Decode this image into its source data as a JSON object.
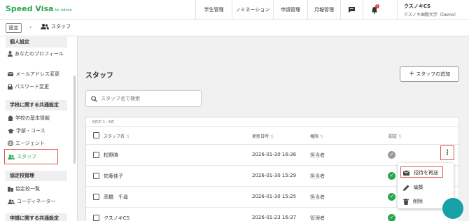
{
  "brand": {
    "name": "Speed Visa",
    "sub": "for Admin"
  },
  "nav": {
    "students": "学生管理",
    "nomination": "ノミネーション",
    "applications": "申請管理",
    "monthly": "月報管理",
    "notif_count": "1"
  },
  "user": {
    "name": "クスノキCS",
    "org": "クスノキ国際大学（Demo）"
  },
  "breadcrumb": {
    "settings": "設定",
    "current": "スタッフ"
  },
  "sidebar": {
    "personal_title": "個人設定",
    "profile": "あなたのプロフィール",
    "email": "メールアドレス変更",
    "password": "パスワード変更",
    "school_title": "学校に関する共通設定",
    "basic": "学校の基本情報",
    "faculty": "学部・コース",
    "agent": "エージェント",
    "staff": "スタッフ",
    "partner_title": "協定校管理",
    "partner_list": "協定校一覧",
    "coordinator": "コーディネーター",
    "apply_title": "申請に関する共通設定"
  },
  "main": {
    "title": "スタッフ",
    "add_button": "スタッフの追加",
    "search_placeholder": "スタッフ名で検索",
    "count": "6件中 1 - 6件",
    "columns": {
      "name": "スタッフ名",
      "updated": "更新日時",
      "role": "権限",
      "auth": "認証"
    },
    "rows": [
      {
        "name": "松野時",
        "updated": "2026-01-30 16:36",
        "role": "担当者",
        "verified": false
      },
      {
        "name": "佐藤佳子",
        "updated": "2026-01-30 15:29",
        "role": "担当者",
        "verified": true
      },
      {
        "name": "高橋　千尋",
        "updated": "2026-01-30 15:25",
        "role": "担当者",
        "verified": true
      },
      {
        "name": "クスノキCS",
        "updated": "2026-01-23 16:37",
        "role": "管理者",
        "verified": true
      }
    ]
  },
  "menu": {
    "resend": "招待を再送",
    "edit": "編集",
    "delete": "削除"
  },
  "colors": {
    "brand": "#2aa550",
    "verified": "#2aa550",
    "unverified": "#9a9a9a",
    "highlight": "#e05555"
  }
}
